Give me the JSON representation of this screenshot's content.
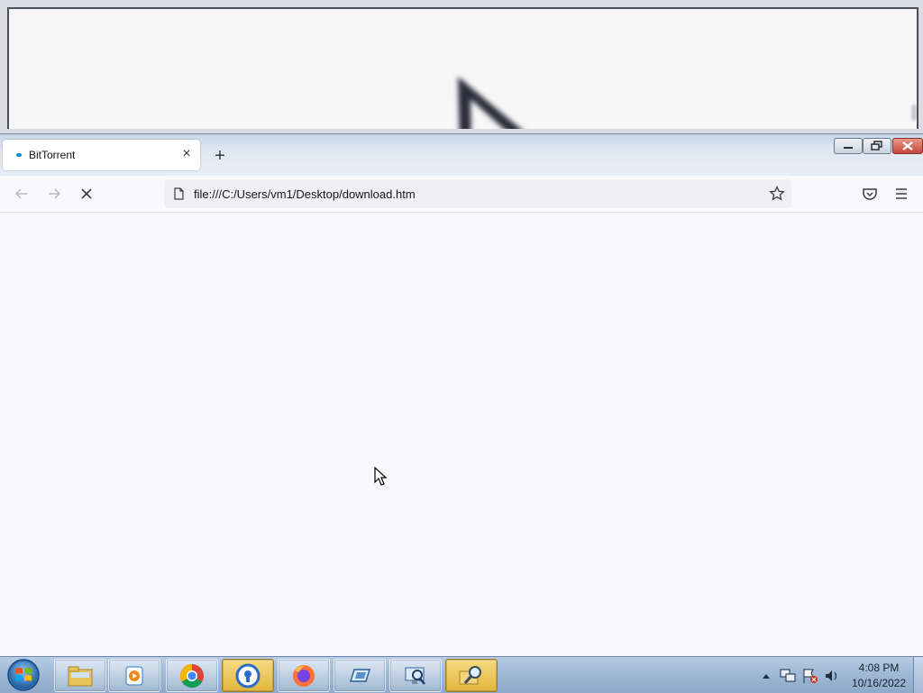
{
  "browser": {
    "tab": {
      "title": "BitTorrent",
      "close_label": "×"
    },
    "new_tab_label": "+",
    "url": "file:///C:/Users/vm1/Desktop/download.htm"
  },
  "taskbar": {
    "apps": [
      "windows-explorer",
      "media-player",
      "chrome",
      "security-app",
      "firefox",
      "remote-desktop",
      "network-tool",
      "search-tool"
    ],
    "clock": {
      "time": "4:08 PM",
      "date": "10/16/2022"
    }
  }
}
